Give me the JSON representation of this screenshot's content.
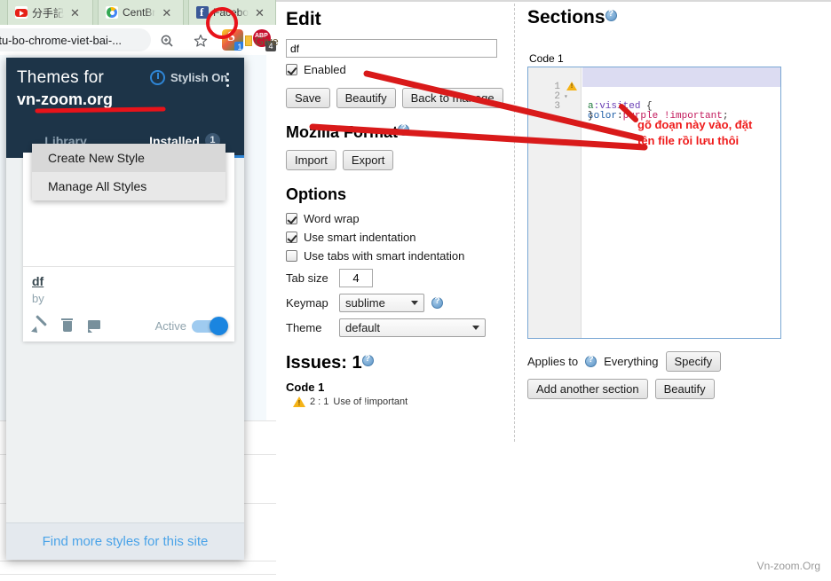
{
  "browser": {
    "tabs": [
      {
        "title": "分手記",
        "favicon": "youtube-icon",
        "close": "✕"
      },
      {
        "title": "CentBr",
        "favicon": "centbrowser-icon",
        "close": "✕"
      },
      {
        "title": "Facebo",
        "favicon": "facebook-icon",
        "close": "✕"
      }
    ],
    "omnibox": {
      "url": "-tu-bo-chrome-viet-bai-..."
    },
    "zoom_icon": "zoom-in-icon",
    "bookmark_icon": "star-icon",
    "extensions": [
      {
        "name": "stylish-extension-icon",
        "badge": "1"
      },
      {
        "name": "adblock-plus-icon",
        "badge": "4"
      }
    ],
    "give_label": "Give"
  },
  "stylish_popup": {
    "title": "Themes for",
    "site": "vn-zoom.org",
    "power_label": "Stylish On",
    "kebab_label": "⋮",
    "tabs": [
      {
        "label": "Library",
        "count": ""
      },
      {
        "label": "Installed",
        "count": "1"
      }
    ],
    "menu": [
      {
        "label": "Create New Style"
      },
      {
        "label": "Manage All Styles"
      }
    ],
    "style_card": {
      "name": "df",
      "by": "by",
      "edit_icon": "pencil-icon",
      "delete_icon": "trash-icon",
      "comment_icon": "comment-icon",
      "toggle_label": "Active"
    },
    "footer_link": "Find more styles for this site"
  },
  "editor": {
    "edit_title": "Edit",
    "name_value": "df",
    "name_placeholder": "",
    "enabled_label": "Enabled",
    "enabled_checked": true,
    "buttons": {
      "save": "Save",
      "beautify": "Beautify",
      "back_to_manage": "Back to manage"
    },
    "mozilla_format": {
      "title": "Mozilla Format",
      "import": "Import",
      "export": "Export"
    },
    "options": {
      "title": "Options",
      "checkboxes": [
        {
          "label": "Word wrap",
          "checked": true
        },
        {
          "label": "Use smart indentation",
          "checked": true
        },
        {
          "label": "Use tabs with smart indentation",
          "checked": false
        }
      ],
      "tab_size_label": "Tab size",
      "tab_size_value": "4",
      "keymap_label": "Keymap",
      "keymap_value": "sublime",
      "theme_label": "Theme",
      "theme_value": "default"
    },
    "issues": {
      "title": "Issues: 1",
      "group": "Code 1",
      "position": "2 : 1",
      "message": "Use of !important"
    }
  },
  "sections": {
    "title": "Sections",
    "code_label": "Code 1",
    "code_lines": [
      {
        "no": "1",
        "fold": "▾",
        "warn": false,
        "text": "a:visited {"
      },
      {
        "no": "2",
        "fold": "",
        "warn": true,
        "text": "color:purple !important;"
      },
      {
        "no": "3",
        "fold": "",
        "warn": false,
        "text": "}"
      }
    ],
    "applies_to_label": "Applies to",
    "applies_to_value": "Everything",
    "specify_button": "Specify",
    "add_section_button": "Add another section",
    "beautify_button": "Beautify"
  },
  "annotation": {
    "text_line1": "gõ đoạn này vào, đặt",
    "text_line2": "tên file rồi lưu thôi",
    "color": "#ef1b1b"
  },
  "watermark": "Vn-zoom.Org",
  "colors": {
    "popup_header": "#1d3448",
    "accent_blue": "#2f86d6",
    "annotation_red": "#e8131a",
    "link_blue": "#4aa3e8"
  }
}
